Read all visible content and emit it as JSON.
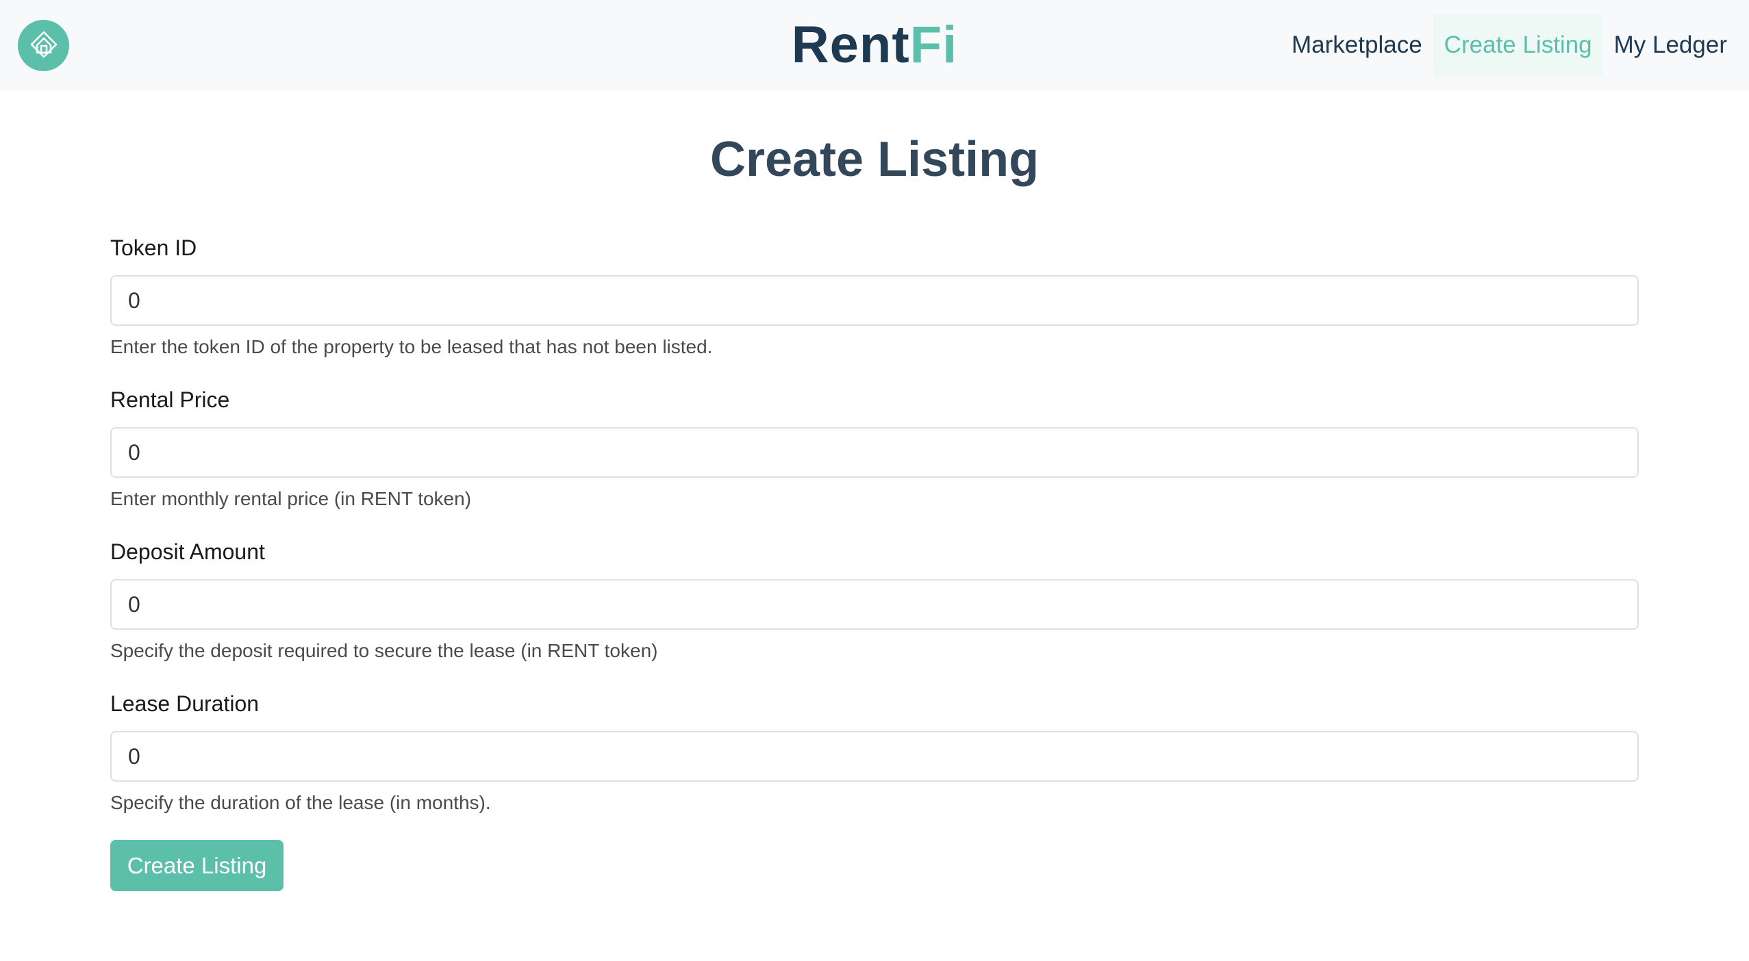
{
  "header": {
    "logo_icon": "house-icon",
    "brand_part1": "Rent",
    "brand_part2": "Fi",
    "nav": [
      {
        "label": "Marketplace",
        "active": false
      },
      {
        "label": "Create Listing",
        "active": true
      },
      {
        "label": "My Ledger",
        "active": false
      }
    ]
  },
  "page": {
    "title": "Create Listing"
  },
  "form": {
    "fields": [
      {
        "label": "Token ID",
        "value": "0",
        "help": "Enter the token ID of the property to be leased that has not been listed."
      },
      {
        "label": "Rental Price",
        "value": "0",
        "help": "Enter monthly rental price (in RENT token)"
      },
      {
        "label": "Deposit Amount",
        "value": "0",
        "help": "Specify the deposit required to secure the lease (in RENT token)"
      },
      {
        "label": "Lease Duration",
        "value": "0",
        "help": "Specify the duration of the lease (in months)."
      }
    ],
    "submit_label": "Create Listing"
  },
  "colors": {
    "accent": "#5bbfaa",
    "brand_dark": "#1d3a52",
    "title": "#33475b",
    "navbar_bg": "#f7f9fa"
  }
}
